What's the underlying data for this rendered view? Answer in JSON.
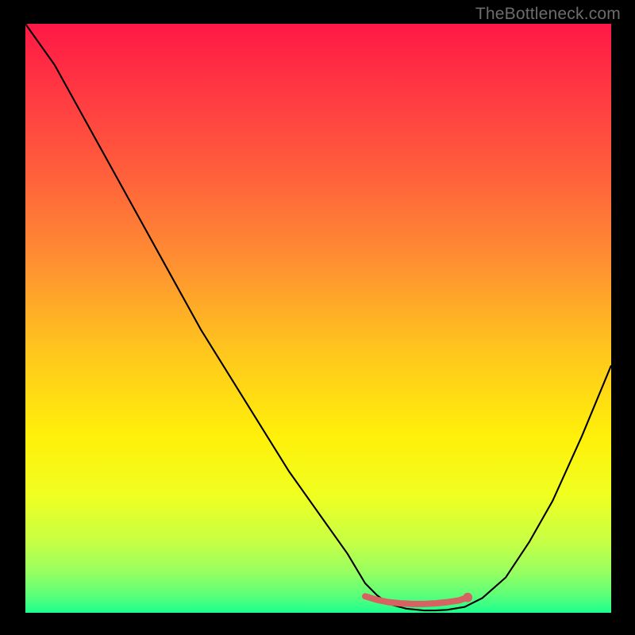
{
  "watermark": "TheBottleneck.com",
  "chart_data": {
    "type": "line",
    "title": "",
    "xlabel": "",
    "ylabel": "",
    "xlim": [
      0,
      100
    ],
    "ylim": [
      0,
      100
    ],
    "series": [
      {
        "name": "bottleneck-curve",
        "x": [
          0,
          5,
          10,
          15,
          20,
          25,
          30,
          35,
          40,
          45,
          50,
          55,
          58,
          60,
          62,
          65,
          68,
          70,
          72,
          75,
          78,
          82,
          86,
          90,
          95,
          100
        ],
        "y": [
          100,
          93,
          84,
          75,
          66,
          57,
          48,
          40,
          32,
          24,
          17,
          10,
          5,
          3,
          1.5,
          0.7,
          0.4,
          0.4,
          0.5,
          1,
          2.5,
          6,
          12,
          19,
          30,
          42
        ],
        "color": "#000000",
        "width": 2.1
      }
    ],
    "highlight": {
      "name": "sweet-spot",
      "x": [
        58,
        60,
        62,
        64,
        66,
        68,
        70,
        72,
        74,
        75.5
      ],
      "y": [
        2.8,
        2.2,
        1.8,
        1.6,
        1.5,
        1.5,
        1.6,
        1.8,
        2.1,
        2.6
      ],
      "color": "#d66262",
      "width": 8,
      "end_dot_radius": 6
    },
    "background_gradient": {
      "stops": [
        {
          "offset": 0.0,
          "color": "#ff1846"
        },
        {
          "offset": 0.12,
          "color": "#ff3a42"
        },
        {
          "offset": 0.25,
          "color": "#ff5e3c"
        },
        {
          "offset": 0.4,
          "color": "#ff8e32"
        },
        {
          "offset": 0.55,
          "color": "#ffc41e"
        },
        {
          "offset": 0.7,
          "color": "#fff00a"
        },
        {
          "offset": 0.8,
          "color": "#f0ff20"
        },
        {
          "offset": 0.88,
          "color": "#c6ff45"
        },
        {
          "offset": 0.93,
          "color": "#98ff60"
        },
        {
          "offset": 0.97,
          "color": "#5cff7a"
        },
        {
          "offset": 1.0,
          "color": "#1cff8e"
        }
      ]
    }
  }
}
